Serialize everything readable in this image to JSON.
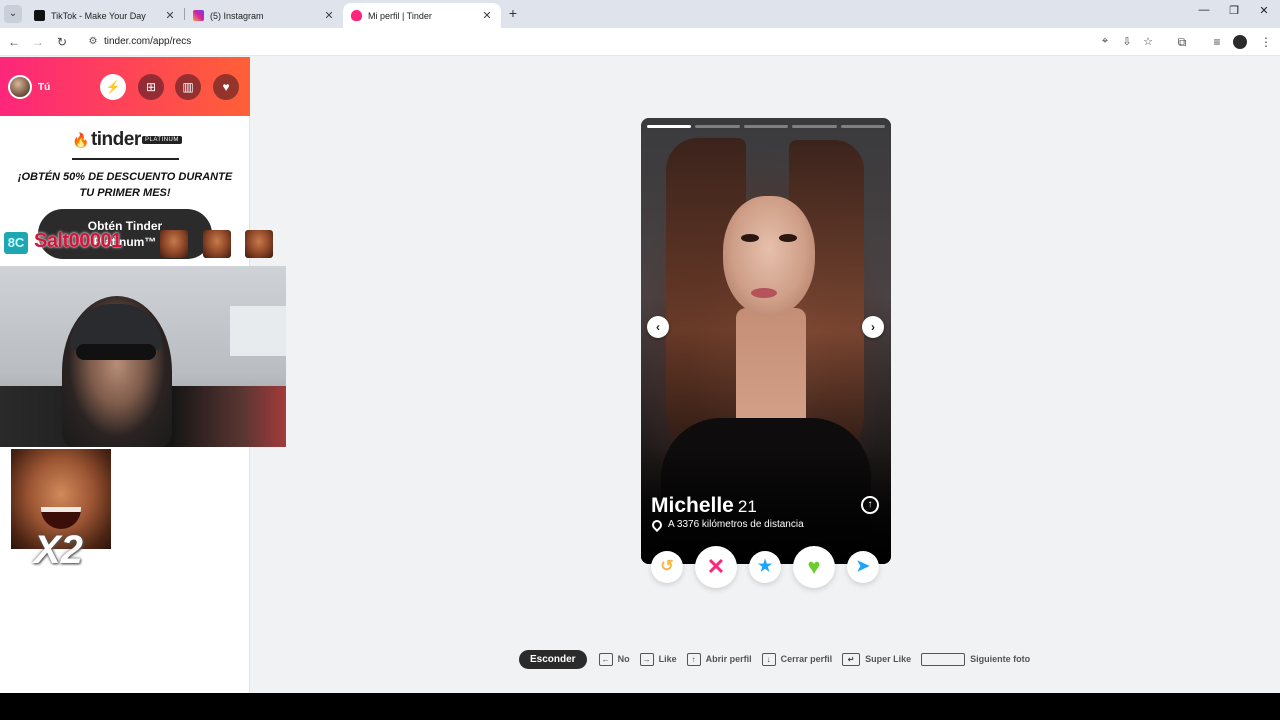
{
  "browser": {
    "tabs": [
      {
        "title": "TikTok - Make Your Day",
        "favicon_color": "#111111"
      },
      {
        "title": "(5) Instagram",
        "favicon_color": "#d6249f"
      },
      {
        "title": "Mi perfil | Tinder",
        "favicon_color": "#fd267a"
      }
    ],
    "url": "tinder.com/app/recs"
  },
  "sidebar": {
    "user_label": "Tú",
    "logo_text": "tinder",
    "tier_badge": "PLATINUM",
    "promo_line1": "¡OBTÉN 50% DE DESCUENTO DURANTE",
    "promo_line2": "TU PRIMER MES!",
    "cta_label": "Obtén Tinder",
    "cta_label_2": "Platinum™",
    "icons": [
      "bolt-icon",
      "explore-icon",
      "gift-icon",
      "shield-icon"
    ]
  },
  "overlay": {
    "badge": "8C",
    "username": "Salt00001",
    "multiplier": "X2"
  },
  "profile": {
    "name": "Michelle",
    "age": "21",
    "distance": "A 3376 kilómetros de distancia",
    "photo_index": 0,
    "photo_count": 5
  },
  "actions": [
    {
      "name": "rewind",
      "glyph": "↺",
      "color": "#f5b748"
    },
    {
      "name": "nope",
      "glyph": "✕",
      "color": "#fd267a"
    },
    {
      "name": "super-like",
      "glyph": "★",
      "color": "#1ca4fc"
    },
    {
      "name": "like",
      "glyph": "♥",
      "color": "#6ccb2f"
    },
    {
      "name": "boost",
      "glyph": "➤",
      "color": "#1ca4fc"
    }
  ],
  "shortcuts": {
    "hide": "Esconder",
    "no": "No",
    "like": "Like",
    "open_profile": "Abrir perfil",
    "close_profile": "Cerrar perfil",
    "super_like": "Super Like",
    "next_photo": "Siguiente foto"
  }
}
